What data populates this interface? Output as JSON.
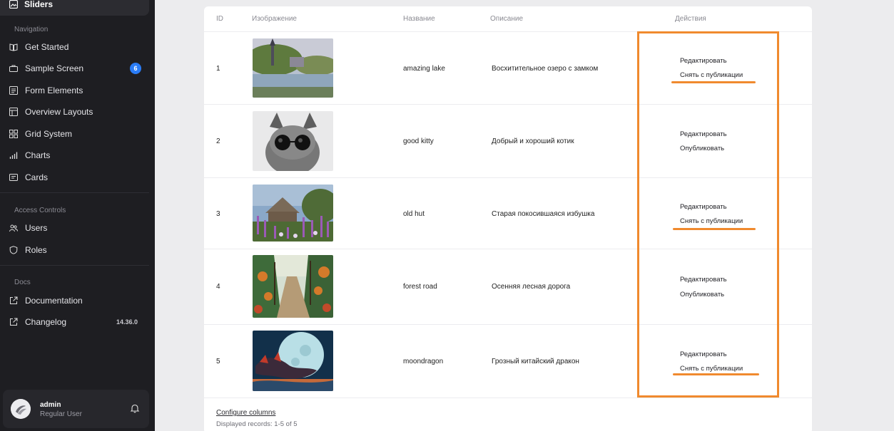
{
  "sidebar": {
    "active_item": "Sliders",
    "sections": [
      {
        "title": "Navigation"
      },
      {
        "title": "Access Controls"
      },
      {
        "title": "Docs"
      }
    ],
    "nav": {
      "get_started": "Get Started",
      "sample_screen": "Sample Screen",
      "sample_screen_badge": "6",
      "form_elements": "Form Elements",
      "overview_layouts": "Overview Layouts",
      "grid_system": "Grid System",
      "charts": "Charts",
      "cards": "Cards",
      "users": "Users",
      "roles": "Roles",
      "documentation": "Documentation",
      "changelog": "Changelog",
      "changelog_version": "14.36.0"
    },
    "user": {
      "name": "admin",
      "role": "Regular User"
    }
  },
  "table": {
    "headers": {
      "id": "ID",
      "image": "Изображение",
      "name": "Название",
      "description": "Описание",
      "actions": "Действия"
    },
    "rows": [
      {
        "id": "1",
        "name": "amazing lake",
        "description": "Восхитительное озеро с замком",
        "edit": "Редактировать",
        "publish": "Снять с публикации",
        "image": "painting of a lake with a castle"
      },
      {
        "id": "2",
        "name": "good kitty",
        "description": "Добрый и хороший котик",
        "edit": "Редактировать",
        "publish": "Опубликовать",
        "image": "grey cat wearing round sunglasses"
      },
      {
        "id": "3",
        "name": "old hut",
        "description": "Старая покосившаяся избушка",
        "edit": "Редактировать",
        "publish": "Снять с публикации",
        "image": "painting of an old hut with flowers"
      },
      {
        "id": "4",
        "name": "forest road",
        "description": "Осенняя лесная дорога",
        "edit": "Редактировать",
        "publish": "Опубликовать",
        "image": "painting of an autumn forest road"
      },
      {
        "id": "5",
        "name": "moondragon",
        "description": "Грозный китайский дракон",
        "edit": "Редактировать",
        "publish": "Снять с публикации",
        "image": "dragon in front of a full moon"
      }
    ],
    "footer": {
      "configure": "Configure columns",
      "records": "Displayed records: 1-5 of 5"
    }
  },
  "colors": {
    "accent": "#f08a2e",
    "badge": "#2a7cf6",
    "sidebar_bg": "#1e1e22"
  }
}
